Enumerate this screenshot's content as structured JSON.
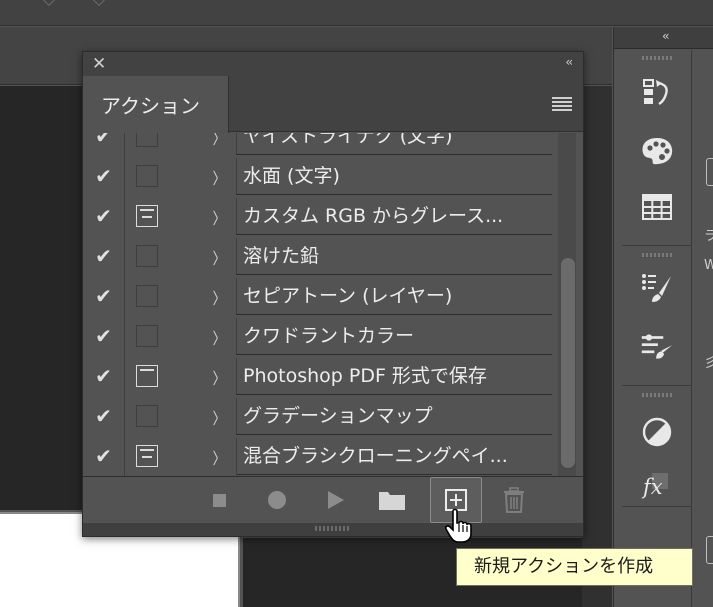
{
  "panel": {
    "tab_label": "アクション",
    "close_glyph": "✕",
    "collapse_glyph": "‹‹"
  },
  "dock": {
    "collapse_glyph": "‹‹"
  },
  "actions": [
    {
      "name": "ヤイストライナク (文字)",
      "checked": true,
      "dialog": "none",
      "expand": "〉"
    },
    {
      "name": "水面 (文字)",
      "checked": true,
      "dialog": "none",
      "expand": "〉"
    },
    {
      "name": "カスタム RGB からグレース...",
      "checked": true,
      "dialog": "mixed",
      "expand": "〉"
    },
    {
      "name": "溶けた鉛",
      "checked": true,
      "dialog": "none",
      "expand": "〉"
    },
    {
      "name": "セピアトーン (レイヤー)",
      "checked": true,
      "dialog": "none",
      "expand": "〉"
    },
    {
      "name": "クワドラントカラー",
      "checked": true,
      "dialog": "none",
      "expand": "〉"
    },
    {
      "name": "Photoshop PDF 形式で保存",
      "checked": true,
      "dialog": "on",
      "expand": "〉"
    },
    {
      "name": "グラデーションマップ",
      "checked": true,
      "dialog": "none",
      "expand": "〉"
    },
    {
      "name": "混合ブラシクローニングペイ...",
      "checked": true,
      "dialog": "mixed",
      "expand": "〉"
    }
  ],
  "check_glyph": "✔",
  "tooltip": {
    "text": "新規アクションを作成"
  },
  "icons": {
    "stop": "stop-icon",
    "record": "record-icon",
    "play": "play-icon",
    "new_set": "folder-icon",
    "new_action": "new-action-icon",
    "delete": "trash-icon"
  },
  "side_text": {
    "a": "ラ",
    "b": "W",
    "c": "彡"
  }
}
